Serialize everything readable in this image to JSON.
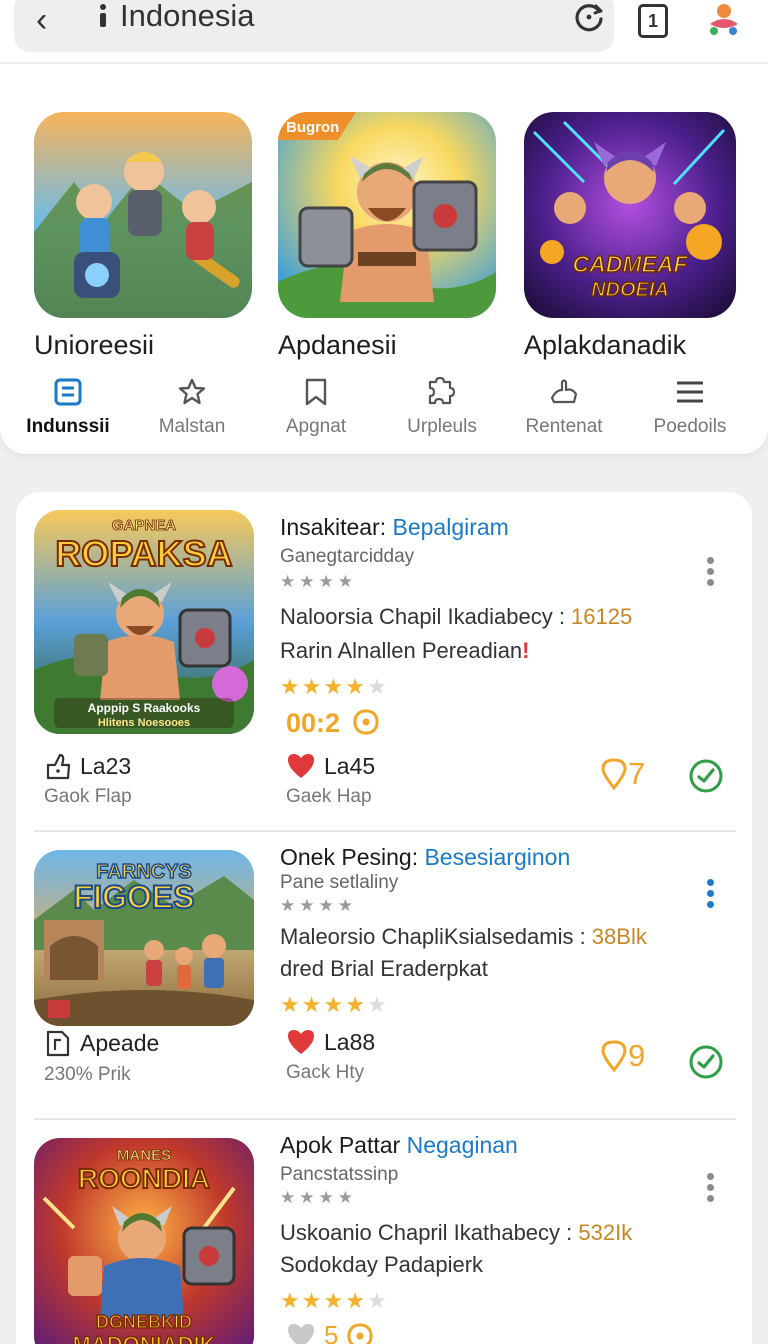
{
  "browser": {
    "url_text": "Indonesia",
    "back_icon": "‹",
    "tab_count": "1"
  },
  "featured": [
    {
      "label": "Unioreesii"
    },
    {
      "label": "Apdanesii",
      "badge": "Bugron"
    },
    {
      "label": "Aplakdanadik",
      "art_text": [
        "CADMEAF",
        "NDOEIA"
      ]
    }
  ],
  "nav": [
    {
      "label": "Indunssii",
      "icon": "list-icon",
      "active": true
    },
    {
      "label": "Malstan",
      "icon": "star-icon"
    },
    {
      "label": "Apgnat",
      "icon": "bookmark-icon"
    },
    {
      "label": "Urpleuls",
      "icon": "puzzle-icon"
    },
    {
      "label": "Rentenat",
      "icon": "hand-icon"
    },
    {
      "label": "Poedoils",
      "icon": "menu-icon"
    }
  ],
  "apps": [
    {
      "title_a": "Insakitear: ",
      "title_b": "Bepalgiram",
      "sub": "Ganegtarcidday",
      "grey_stars": "★★★★",
      "desc1": "Naloorsia Chapil Ikadiabecy : ",
      "desc1_num": "16125",
      "desc2": "Rarin Alnallen Pereadian",
      "desc2_mark": "!",
      "rating": 4,
      "timer": "00:2",
      "meta_left_value": "La23",
      "meta_left_sub": "Gaok Flap",
      "meta_mid_value": "La45",
      "meta_mid_sub": "Gaek Hap",
      "count": "7",
      "art_text": [
        "GAPNEA",
        "ROPAKSA",
        "Apppip S Raakooks",
        "Hlitens Noesooes"
      ]
    },
    {
      "title_a": "Onek Pesing: ",
      "title_b": "Besesiarginon",
      "sub": "Pane setlaliny",
      "grey_stars": "★★★★",
      "desc1": "Maleorsio ChapliKsialsedamis : ",
      "desc1_num": "38Blk",
      "desc2": "dred Brial Eraderpkat",
      "desc2_mark": "",
      "rating": 4,
      "meta_left_value": "Apeade",
      "meta_left_sub": "230% Prik",
      "meta_mid_value": "La88",
      "meta_mid_sub": "Gack Hty",
      "count": "9",
      "art_text": [
        "FARNCYS",
        "FIGOES"
      ]
    },
    {
      "title_a": "Apok Pattar ",
      "title_b": "Negaginan",
      "sub": "Pancstatssinp",
      "grey_stars": "★★★★",
      "desc1": "Uskoanio Chapril Ikathabecy : ",
      "desc1_num": "532Ik",
      "desc2": "Sodokday Padapierk",
      "desc2_mark": "",
      "rating": 4,
      "timer": "5",
      "art_text": [
        "MANES",
        "ROONDIA",
        "DGNEBKID",
        "MADONIADIK"
      ]
    }
  ],
  "colors": {
    "accent_blue": "#1b7ac7",
    "orange": "#f0a629",
    "green": "#2e9e47",
    "heart": "#e0393a"
  }
}
